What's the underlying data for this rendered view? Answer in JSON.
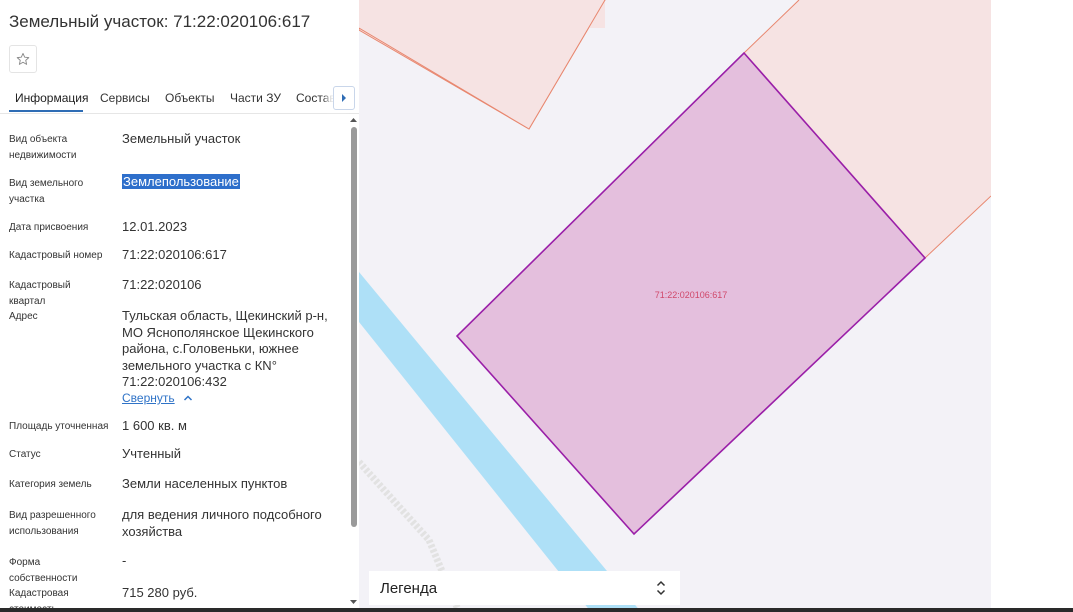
{
  "header": {
    "title": "Земельный участок: 71:22:020106:617"
  },
  "tabs": [
    {
      "label": "Информация",
      "active": true
    },
    {
      "label": "Сервисы"
    },
    {
      "label": "Объекты"
    },
    {
      "label": "Части ЗУ"
    },
    {
      "label": "Состав"
    }
  ],
  "properties": {
    "object_type": {
      "label": "Вид объекта недвижимости",
      "value": "Земельный участок"
    },
    "land_type": {
      "label": "Вид земельного участка",
      "value": "Землепользование"
    },
    "assigned_date": {
      "label": "Дата присвоения",
      "value": "12.01.2023"
    },
    "cadastral_number": {
      "label": "Кадастровый номер",
      "value": "71:22:020106:617"
    },
    "cadastral_quarter": {
      "label": "Кадастровый квартал",
      "value": "71:22:020106"
    },
    "address": {
      "label": "Адрес",
      "value": "Тульская область, Щекинский р-н, МО Яснополянское Щекинского района, с.Головеньки, южнее земельного участка с КN° 71:22:020106:432",
      "collapse_label": "Свернуть"
    },
    "area": {
      "label": "Площадь уточненная",
      "value": "1 600 кв. м"
    },
    "status": {
      "label": "Статус",
      "value": "Учтенный"
    },
    "land_category": {
      "label": "Категория земель",
      "value": "Земли населенных пунктов"
    },
    "permitted_use": {
      "label": "Вид разрешенного использования",
      "value": "для ведения личного подсобного хозяйства"
    },
    "ownership": {
      "label": "Форма собственности",
      "value": "-"
    },
    "cadastral_value": {
      "label": "Кадастровая стоимость",
      "value": "715 280 руб."
    }
  },
  "map": {
    "parcel_label": "71:22:020106:617",
    "legend_label": "Легенда"
  },
  "colors": {
    "accent": "#2f6db5",
    "parcel_fill": "#e4bfdd",
    "parcel_stroke": "#9a1fa8",
    "neighbor_fill": "#f6e3e3",
    "neighbor_stroke": "#e8876f",
    "river": "#aee0f7",
    "map_bg": "#f3f2f7"
  }
}
